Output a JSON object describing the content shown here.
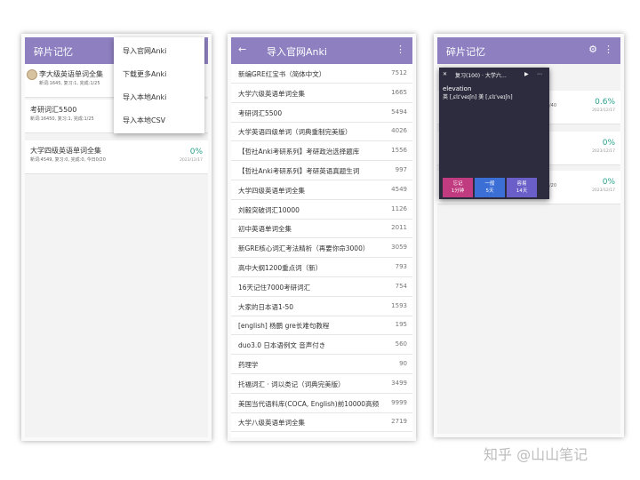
{
  "phone1": {
    "app_title": "碎片记忆",
    "decks": [
      {
        "name": "李大级英语单词全集",
        "info": "新词:1645, 复习:1, 完成:1/25",
        "pct": "",
        "date": ""
      },
      {
        "name": "考研词汇5500",
        "info": "新词:16450, 复习:1, 完成:1/25",
        "pct": "",
        "date": ""
      },
      {
        "name": "大学四级英语单词全集",
        "info": "新词:4549, 复习:0, 完成:0, 今日0/20",
        "pct": "0%",
        "date": "2023/12/17"
      }
    ],
    "menu": [
      "导入官网Anki",
      "下载更多Anki",
      "导入本地Anki",
      "导入本地CSV"
    ]
  },
  "phone2": {
    "title": "导入官网Anki",
    "back_icon": "arrow-left-icon",
    "more_icon": "more-vert-icon",
    "rows": [
      {
        "name": "新编GRE红宝书（简体中文）",
        "count": "7512"
      },
      {
        "name": "大学六级英语单词全集",
        "count": "1665"
      },
      {
        "name": "考研词汇5500",
        "count": "5494"
      },
      {
        "name": "大学英语四级单词（词典重制完美版）",
        "count": "4026"
      },
      {
        "name": "【哲社Anki考研系列】考研政治选择题库",
        "count": "1556"
      },
      {
        "name": "【哲社Anki考研系列】考研英语真题生词",
        "count": "997"
      },
      {
        "name": "大学四级英语单词全集",
        "count": "4549"
      },
      {
        "name": "刘毅突破词汇10000",
        "count": "1126"
      },
      {
        "name": "初中英语单词全集",
        "count": "2011"
      },
      {
        "name": "新GRE核心词汇考法精析（再要你命3000）",
        "count": "3059"
      },
      {
        "name": "高中大纲1200重点词（新）",
        "count": "793"
      },
      {
        "name": "16天记住7000考研词汇",
        "count": "754"
      },
      {
        "name": "大家的日本语1-50",
        "count": "1593"
      },
      {
        "name": "[english] 杨鹏 gre长难句教程",
        "count": "195"
      },
      {
        "name": "duo3.0 日本语例文 音声付き",
        "count": "560"
      },
      {
        "name": "药理学",
        "count": "90"
      },
      {
        "name": "托福词汇 · 词以类记（词典完美版）",
        "count": "3499"
      },
      {
        "name": "美国当代语料库(COCA, English)前10000高频",
        "count": "9999"
      },
      {
        "name": "大学八级英语单词全集",
        "count": "2719"
      }
    ]
  },
  "phone3": {
    "app_title": "碎片记忆",
    "gear_icon": "gear-icon",
    "more_icon": "more-vert-icon",
    "decks": [
      {
        "pct": "0.6%",
        "info": "/40",
        "date": "2023/12/17"
      },
      {
        "pct": "0%",
        "info": "",
        "date": "2023/12/17"
      },
      {
        "pct": "0%",
        "info": "/20",
        "date": "2023/12/17"
      }
    ],
    "popup": {
      "header": "复习(100) · 大学六…",
      "word": "elevation",
      "phonetic": "英 [ˌɛlɪˈveɪʃn] 美 [ˌɛlɪˈveɪʃn]",
      "answers": [
        {
          "label": "忘记",
          "sub": "1分钟",
          "color": "#c03b7f"
        },
        {
          "label": "一般",
          "sub": "5天",
          "color": "#3b6fd6"
        },
        {
          "label": "容易",
          "sub": "14天",
          "color": "#6a5ec8"
        }
      ]
    }
  },
  "watermark": "知乎 @山山笔记"
}
